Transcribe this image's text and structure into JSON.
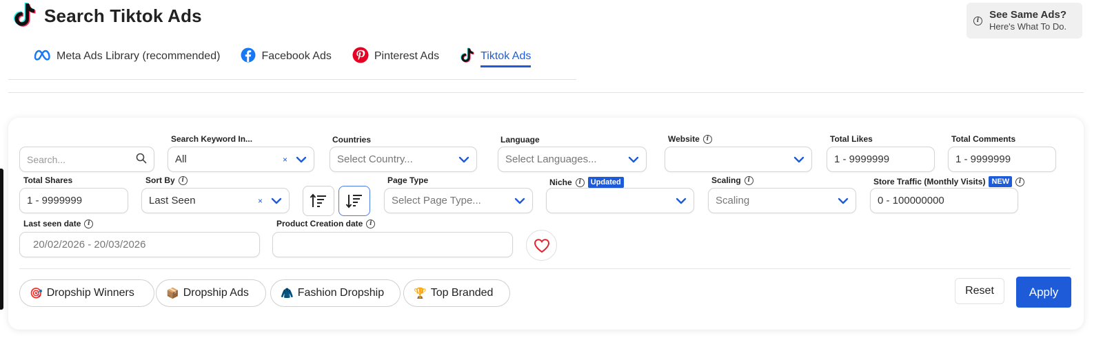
{
  "header": {
    "title": "Search Tiktok Ads",
    "help_line1": "See Same Ads?",
    "help_line2": "Here's What To Do."
  },
  "tabs": [
    {
      "label": "Meta Ads Library (recommended)",
      "icon": "meta-icon",
      "active": false
    },
    {
      "label": "Facebook Ads",
      "icon": "facebook-icon",
      "active": false
    },
    {
      "label": "Pinterest Ads",
      "icon": "pinterest-icon",
      "active": false
    },
    {
      "label": "Tiktok Ads",
      "icon": "tiktok-icon",
      "active": true
    }
  ],
  "filters": {
    "search": {
      "placeholder": "Search..."
    },
    "search_keyword_in": {
      "label": "Search Keyword In...",
      "value": "All"
    },
    "countries": {
      "label": "Countries",
      "placeholder": "Select Country..."
    },
    "language": {
      "label": "Language",
      "placeholder": "Select Languages..."
    },
    "website": {
      "label": "Website",
      "value": ""
    },
    "total_likes": {
      "label": "Total Likes",
      "value": "1 - 9999999"
    },
    "total_comments": {
      "label": "Total Comments",
      "value": "1 - 9999999"
    },
    "total_shares": {
      "label": "Total Shares",
      "value": "1 - 9999999"
    },
    "sort_by": {
      "label": "Sort By",
      "value": "Last Seen"
    },
    "page_type": {
      "label": "Page Type",
      "placeholder": "Select Page Type..."
    },
    "niche": {
      "label": "Niche",
      "badge": "Updated",
      "value": ""
    },
    "scaling": {
      "label": "Scaling",
      "placeholder": "Scaling"
    },
    "store_traffic": {
      "label": "Store Traffic (Monthly Visits)",
      "badge": "NEW",
      "value": "0 - 100000000"
    },
    "last_seen_date": {
      "label": "Last seen date",
      "value": "20/02/2026 - 20/03/2026"
    },
    "product_creation_date": {
      "label": "Product Creation date",
      "value": ""
    },
    "clear_symbol": "×"
  },
  "presets": [
    {
      "emoji": "🎯",
      "label": "Dropship Winners"
    },
    {
      "emoji": "📦",
      "label": "Dropship Ads"
    },
    {
      "emoji": "🧥",
      "label": "Fashion Dropship"
    },
    {
      "emoji": "🏆",
      "label": "Top Branded"
    }
  ],
  "actions": {
    "reset": "Reset",
    "apply": "Apply"
  },
  "colors": {
    "accent": "#1e5bd8",
    "heart": "#e0252f"
  }
}
